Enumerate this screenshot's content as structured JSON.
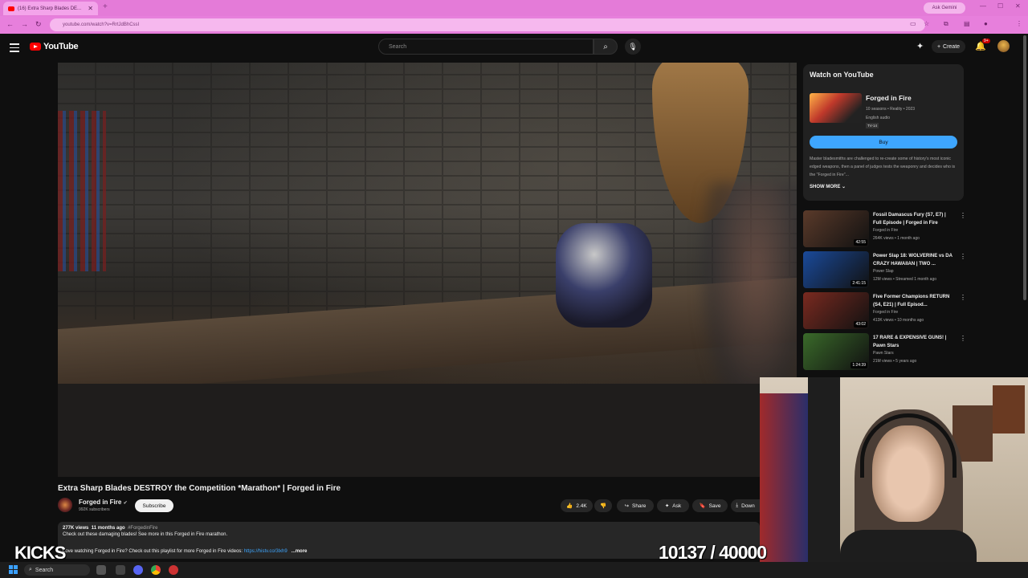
{
  "browser": {
    "tab_title": "(16) Extra Sharp Blades DE...",
    "ask_gemini": "Ask Gemini",
    "url": "youtube.com/watch?v=RrtJdBhCssI"
  },
  "header": {
    "logo_text": "YouTube",
    "search_placeholder": "Search",
    "create_label": "Create",
    "notif_count": "9+"
  },
  "video": {
    "title": "Extra Sharp Blades DESTROY the Competition *Marathon* | Forged in Fire"
  },
  "channel": {
    "name": "Forged in Fire",
    "subs": "992K subscribers",
    "subscribe_label": "Subscribe"
  },
  "actions": {
    "likes": "2.4K",
    "share": "Share",
    "ask": "Ask",
    "save": "Save",
    "download": "Down"
  },
  "description": {
    "views": "277K views",
    "age": "11 months ago",
    "hashtag": "#ForgedinFire",
    "line1": "Check out these damaging blades! See more in this Forged in Fire marathon.",
    "line2": "Love watching Forged in Fire? Check out this playlist for more Forged in Fire videos:",
    "link": "https://histv.co/3lxh9",
    "more": "...more"
  },
  "watch_card": {
    "heading": "Watch on YouTube",
    "show_name": "Forged in Fire",
    "meta1": "10 seasons • Reality • 2023",
    "meta2": "English audio",
    "rating": "TV-14",
    "buy_label": "Buy",
    "desc": "Master bladesmiths are challenged to re-create some of history's most iconic edged weapons, then a panel of judges tests the weaponry and decides who is the \"Forged in Fire\"...",
    "show_more": "SHOW MORE"
  },
  "recommendations": [
    {
      "title": "Fossil Damascus Fury (S7, E7) | Full Episode | Forged in Fire",
      "channel": "Forged in Fire",
      "meta": "264K views • 1 month ago",
      "duration": "42:55",
      "color": "#5a3a2a"
    },
    {
      "title": "Power Slap 18: WOLVERINE vs DA CRAZY HAWAIIAN | TWO ...",
      "channel": "Power Slap",
      "meta": "12M views • Streamed 1 month ago",
      "duration": "2:41:15",
      "color": "#1a4a9a"
    },
    {
      "title": "Five Former Champions RETURN (S4, E21) | Full Episod...",
      "channel": "Forged in Fire",
      "meta": "413K views • 10 months ago",
      "duration": "43:02",
      "color": "#7a2a20"
    },
    {
      "title": "17 RARE & EXPENSIVE GUNS! | Pawn Stars",
      "channel": "Pawn Stars",
      "meta": "21M views • 5 years ago",
      "duration": "1:24:39",
      "color": "#3a6a2a"
    }
  ],
  "overlays": {
    "kicks": "KICKS",
    "counter": "10137 / 40000"
  },
  "taskbar": {
    "search": "Search"
  }
}
